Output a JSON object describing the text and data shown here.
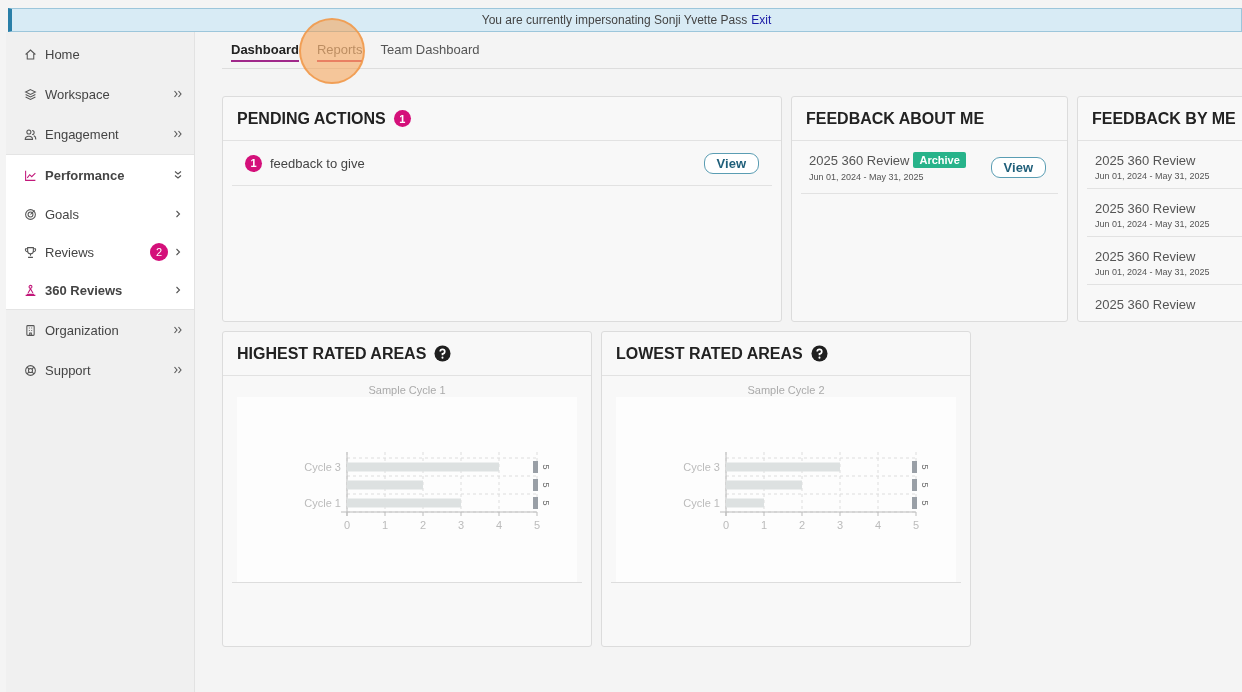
{
  "banner": {
    "text": "You are currently impersonating Sonji Yvette Pass",
    "link": "Exit"
  },
  "sidebar": {
    "items": [
      {
        "label": "Home",
        "kind": "link",
        "selected": false
      },
      {
        "label": "Workspace",
        "kind": "group",
        "expanded": false,
        "selected": false
      },
      {
        "label": "Engagement",
        "kind": "group",
        "expanded": false,
        "selected": false
      },
      {
        "label": "Performance",
        "kind": "group",
        "expanded": true,
        "selected": true,
        "children": [
          {
            "label": "Goals",
            "kind": "sub",
            "selected": false
          },
          {
            "label": "Reviews",
            "kind": "sub",
            "badge": "2",
            "selected": false
          },
          {
            "label": "360 Reviews",
            "kind": "sub",
            "selected": true
          }
        ]
      },
      {
        "label": "Organization",
        "kind": "group",
        "expanded": false,
        "selected": false
      },
      {
        "label": "Support",
        "kind": "group",
        "expanded": false,
        "selected": false
      }
    ]
  },
  "tabs": [
    {
      "label": "Dashboard",
      "selected": true,
      "highlighted": false
    },
    {
      "label": "Reports",
      "selected": false,
      "highlighted": true
    },
    {
      "label": "Team Dashboard",
      "selected": false,
      "highlighted": false
    }
  ],
  "pending_actions": {
    "title": "PENDING ACTIONS",
    "count": "1",
    "items": [
      {
        "count": "1",
        "label": "feedback to give",
        "button": "View"
      }
    ]
  },
  "feedback_about_me": {
    "title": "FEEDBACK ABOUT ME",
    "items": [
      {
        "name": "2025 360 Review",
        "tag": "Archive",
        "dates": "Jun 01, 2024 - May 31, 2025",
        "button": "View"
      }
    ]
  },
  "feedback_by_me": {
    "title": "FEEDBACK BY ME",
    "items": [
      {
        "name": "2025 360 Review",
        "dates": "Jun 01, 2024 - May 31, 2025"
      },
      {
        "name": "2025 360 Review",
        "dates": "Jun 01, 2024 - May 31, 2025"
      },
      {
        "name": "2025 360 Review",
        "dates": "Jun 01, 2024 - May 31, 2025"
      },
      {
        "name": "2025 360 Review"
      }
    ]
  },
  "rated_areas": [
    {
      "title": "HIGHEST RATED AREAS",
      "chart_data": {
        "type": "bar",
        "orientation": "horizontal",
        "grid": true,
        "title": "Sample Cycle 1",
        "categories": [
          "Cycle 3",
          null,
          "Cycle 1"
        ],
        "series": [
          {
            "type": "bar",
            "color": "#dde1e1",
            "data_labels": false,
            "values": [
              4,
              2,
              3
            ]
          },
          {
            "type": "scatter",
            "color": "#999fa6",
            "data_labels": true,
            "values": [
              5,
              5,
              5
            ]
          }
        ],
        "xlim": [
          0,
          5
        ],
        "xticks": [
          0,
          1,
          2,
          3,
          4,
          5
        ]
      }
    },
    {
      "title": "LOWEST RATED AREAS",
      "chart_data": {
        "type": "bar",
        "orientation": "horizontal",
        "grid": true,
        "title": "Sample Cycle 2",
        "categories": [
          "Cycle 3",
          null,
          "Cycle 1"
        ],
        "series": [
          {
            "type": "bar",
            "color": "#dde1e1",
            "data_labels": false,
            "values": [
              3,
              2,
              1
            ]
          },
          {
            "type": "scatter",
            "color": "#999fa6",
            "data_labels": true,
            "values": [
              5,
              5,
              5
            ]
          }
        ],
        "xlim": [
          0,
          5
        ],
        "xticks": [
          0,
          1,
          2,
          3,
          4,
          5
        ]
      }
    }
  ]
}
